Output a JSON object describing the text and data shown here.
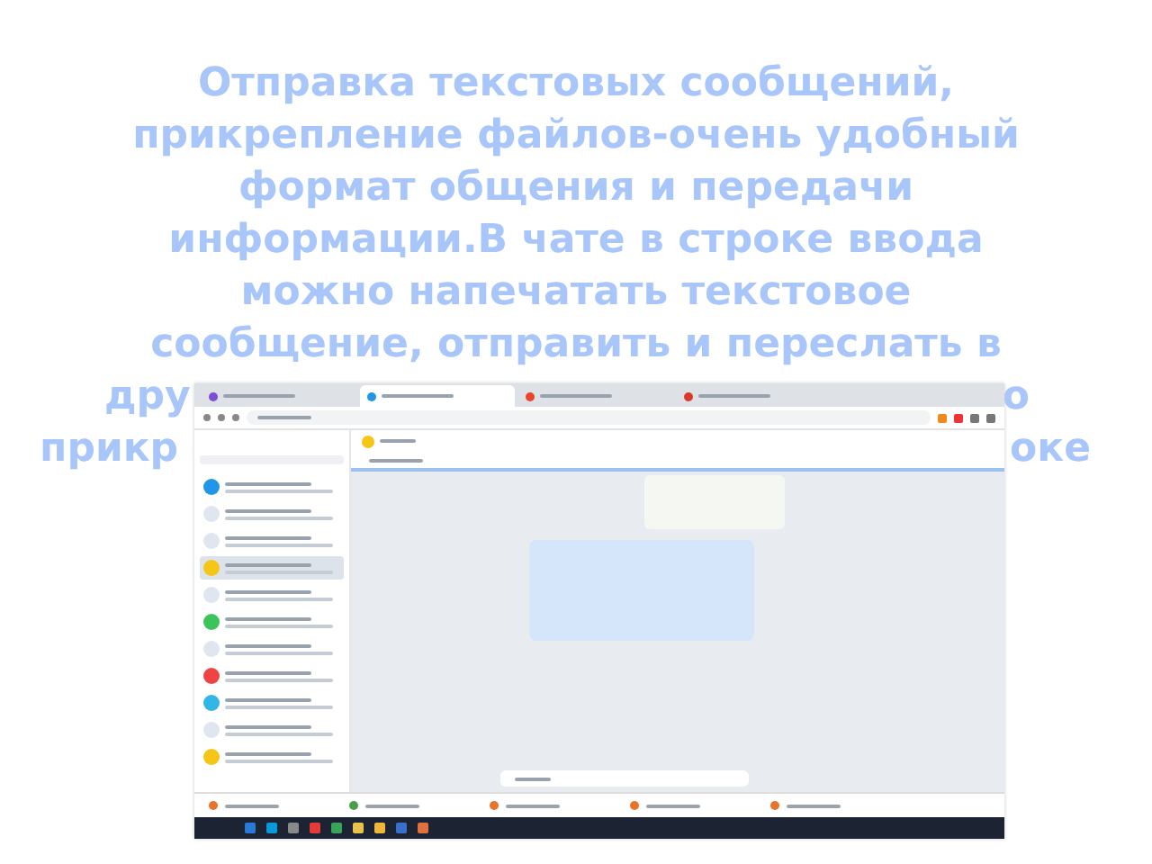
{
  "heading_lines": [
    "Отправка текстовых сообщений,",
    "прикрепление файлов-очень удобный",
    "формат общения и передачи",
    "информации.В чате в строке ввода",
    "можно напечатать текстовое",
    "сообщение, отправить и переслать в"
  ],
  "heading_fragments": [
    {
      "left": "дру",
      "right": "о"
    },
    {
      "left": "прикр",
      "right": "оке"
    }
  ],
  "screenshot": {
    "tabs": [
      {
        "selected": false,
        "color": "#7b4fd6"
      },
      {
        "selected": true,
        "color": "#2196e8"
      },
      {
        "selected": false,
        "color": "#e8452c"
      },
      {
        "selected": false,
        "color": "#d83a2a"
      }
    ],
    "chats": [
      {
        "color": "#2196e8",
        "selected": false
      },
      {
        "color": "#dfe6f0",
        "selected": false
      },
      {
        "color": "#dfe6f0",
        "selected": false
      },
      {
        "color": "#f5c518",
        "selected": true
      },
      {
        "color": "#dfe6f0",
        "selected": false
      },
      {
        "color": "#3cc35a",
        "selected": false
      },
      {
        "color": "#dfe6f0",
        "selected": false
      },
      {
        "color": "#ee4444",
        "selected": false
      },
      {
        "color": "#33b5e5",
        "selected": false
      },
      {
        "color": "#dfe6f0",
        "selected": false
      },
      {
        "color": "#f5c518",
        "selected": false
      }
    ],
    "downloads": [
      {
        "color": "#e8742c"
      },
      {
        "color": "#4a9d4a"
      },
      {
        "color": "#e8742c"
      },
      {
        "color": "#e8742c"
      },
      {
        "color": "#e8742c"
      }
    ],
    "taskbar_icons": [
      {
        "color": "#2a7ad5"
      },
      {
        "color": "#0a9ad8"
      },
      {
        "color": "#8a8a8a"
      },
      {
        "color": "#e33a3a"
      },
      {
        "color": "#3aa55a"
      },
      {
        "color": "#e8c14a"
      },
      {
        "color": "#f0b83a"
      },
      {
        "color": "#3a6fd0"
      },
      {
        "color": "#e07040"
      }
    ]
  }
}
